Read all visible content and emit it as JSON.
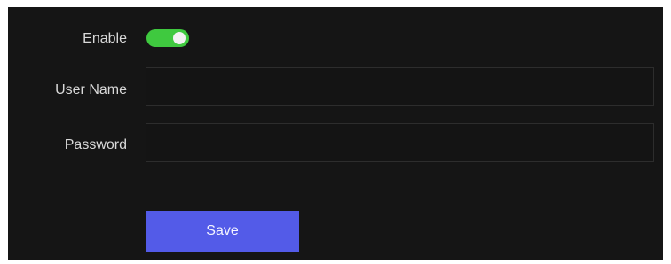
{
  "form": {
    "enable": {
      "label": "Enable",
      "state": "on",
      "on_color": "#3fc93f"
    },
    "user_name": {
      "label": "User Name",
      "value": "",
      "placeholder": ""
    },
    "password": {
      "label": "Password",
      "value": "",
      "placeholder": ""
    },
    "save_label": "Save"
  },
  "colors": {
    "panel_background": "#151515",
    "accent_button": "#535be8",
    "label_text": "#d9d9d9"
  }
}
